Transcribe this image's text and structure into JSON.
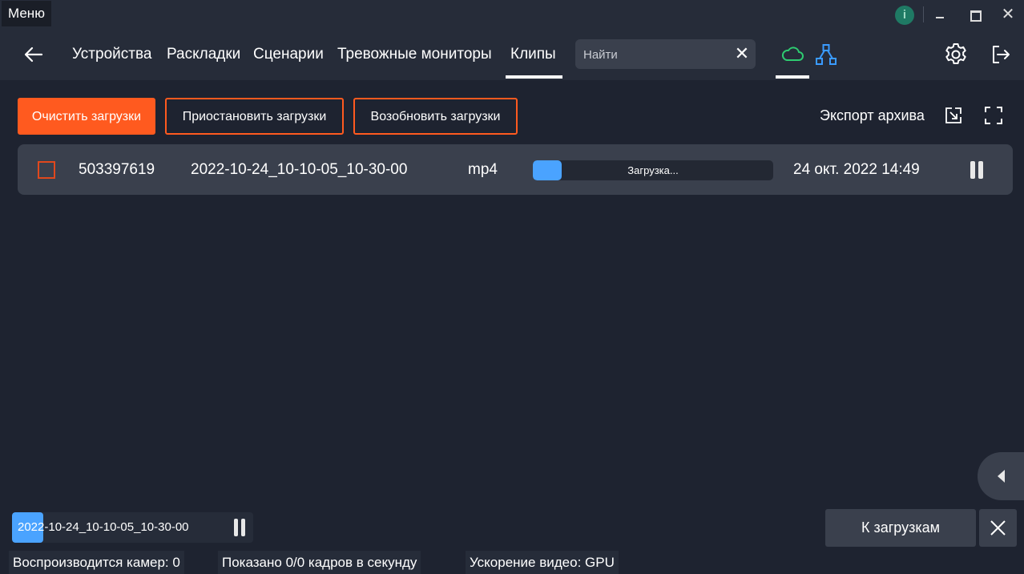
{
  "titlebar": {
    "menu_label": "Меню",
    "info_icon": "i"
  },
  "nav": {
    "items": [
      "Устройства",
      "Раскладки",
      "Сценарии",
      "Тревожные мониторы",
      "Клипы"
    ],
    "active_item": "Клипы",
    "search_placeholder": "Найти",
    "icons": [
      "back-arrow-icon",
      "cloud-icon",
      "network-tree-icon",
      "gear-icon",
      "logout-icon"
    ],
    "active_icon": "cloud-icon"
  },
  "toolbar": {
    "clear_label": "Очистить загрузки",
    "pause_label": "Приостановить загрузки",
    "resume_label": "Возобновить загрузки",
    "export_label": "Экспорт архива"
  },
  "downloads": [
    {
      "id": "503397619",
      "name": "2022-10-24_10-10-05_10-30-00",
      "format": "mp4",
      "status": "Загрузка...",
      "progress": 0.12,
      "date": "24 окт. 2022 14:49",
      "checked": false
    }
  ],
  "player": {
    "clip_name": "2022-10-24_10-10-05_10-30-00",
    "progress": 0.13
  },
  "bottom": {
    "to_downloads_label": "К загрузкам"
  },
  "status_bar": {
    "cameras": "Воспроизводится камер: 0",
    "fps": "Показано 0/0 кадров в секунду",
    "acceleration": "Ускорение видео: GPU"
  },
  "colors": {
    "background": "#1e2330",
    "panel": "#262c39",
    "row": "#3a404d",
    "accent_orange": "#ff5a1f",
    "progress_blue": "#4aa3ff",
    "cloud_green": "#2ecc71",
    "tree_blue": "#3a9bff"
  }
}
